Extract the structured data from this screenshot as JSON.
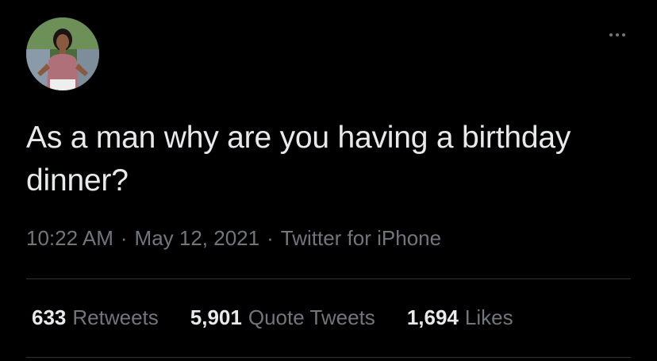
{
  "tweet": {
    "text": "As a man why are you having a birthday dinner?",
    "time": "10:22 AM",
    "date": "May 12, 2021",
    "source": "Twitter for iPhone",
    "separator": "·"
  },
  "stats": {
    "retweets": {
      "count": "633",
      "label": "Retweets"
    },
    "quote_tweets": {
      "count": "5,901",
      "label": "Quote Tweets"
    },
    "likes": {
      "count": "1,694",
      "label": "Likes"
    }
  },
  "icons": {
    "more": "more-horizontal-icon",
    "avatar": "profile-photo"
  },
  "colors": {
    "background": "#000000",
    "text": "#e7e9ea",
    "secondary": "#71767b",
    "divider": "#2f3336"
  }
}
